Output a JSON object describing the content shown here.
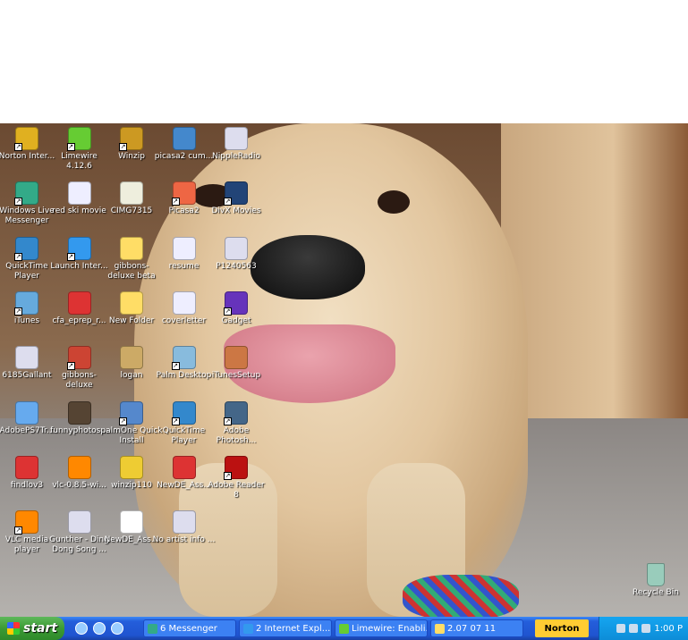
{
  "desktop_icons": [
    {
      "label": "Norton Inter...",
      "color": "#e0b020",
      "shortcut": true
    },
    {
      "label": "Limewire 4.12.6",
      "color": "#6c3",
      "shortcut": true
    },
    {
      "label": "Winzip",
      "color": "#c92",
      "shortcut": true
    },
    {
      "label": "picasa2 cum...",
      "color": "#48c",
      "shortcut": false
    },
    {
      "label": "NippleRadio",
      "color": "#dde",
      "shortcut": false
    },
    {
      "label": "Windows Live Messenger",
      "color": "#3a8",
      "shortcut": true
    },
    {
      "label": "red ski movie",
      "color": "#eef",
      "shortcut": false
    },
    {
      "label": "CIMG7315",
      "color": "#eed",
      "shortcut": false
    },
    {
      "label": "Picasa2",
      "color": "#e64",
      "shortcut": true
    },
    {
      "label": "DivX Movies",
      "color": "#247",
      "shortcut": true
    },
    {
      "label": "QuickTime Player",
      "color": "#38c",
      "shortcut": true
    },
    {
      "label": "Launch Inter...",
      "color": "#39e",
      "shortcut": true
    },
    {
      "label": "gibbons- deluxe beta",
      "color": "#fd6",
      "shortcut": false
    },
    {
      "label": "resume",
      "color": "#eef",
      "shortcut": false
    },
    {
      "label": "P1240563",
      "color": "#dde",
      "shortcut": false
    },
    {
      "label": "iTunes",
      "color": "#6ad",
      "shortcut": true
    },
    {
      "label": "cfa_eprep_r...",
      "color": "#d33",
      "shortcut": false
    },
    {
      "label": "New Folder",
      "color": "#fd6",
      "shortcut": false
    },
    {
      "label": "coverletter",
      "color": "#eef",
      "shortcut": false
    },
    {
      "label": "Gadget",
      "color": "#63b",
      "shortcut": true
    },
    {
      "label": "6185Gallant",
      "color": "#dde",
      "shortcut": false
    },
    {
      "label": "gibbons- deluxe",
      "color": "#c43",
      "shortcut": true
    },
    {
      "label": "logan",
      "color": "#ca6",
      "shortcut": false
    },
    {
      "label": "Palm Desktop",
      "color": "#8bd",
      "shortcut": true
    },
    {
      "label": "iTunesSetup",
      "color": "#c74",
      "shortcut": false
    },
    {
      "label": "AdobePS7Tr...",
      "color": "#6ae",
      "shortcut": false
    },
    {
      "label": "funnyphotos...",
      "color": "#543",
      "shortcut": false
    },
    {
      "label": "palmOne Quick Install",
      "color": "#58c",
      "shortcut": true
    },
    {
      "label": "QuickTime Player",
      "color": "#38c",
      "shortcut": true
    },
    {
      "label": "Adobe Photosh...",
      "color": "#468",
      "shortcut": true
    },
    {
      "label": "findlov3",
      "color": "#d33",
      "shortcut": false
    },
    {
      "label": "vlc-0.8.5-wi...",
      "color": "#f80",
      "shortcut": false
    },
    {
      "label": "winzip110",
      "color": "#ec3",
      "shortcut": false
    },
    {
      "label": "NewDE_Ass...",
      "color": "#d33",
      "shortcut": false
    },
    {
      "label": "Adobe Reader 8",
      "color": "#b11",
      "shortcut": true
    },
    {
      "label": "VLC media player",
      "color": "#f80",
      "shortcut": true
    },
    {
      "label": "Gunther - Ding Dong Song ...",
      "color": "#dde",
      "shortcut": false
    },
    {
      "label": "NewDE_Ass...",
      "color": "#fff",
      "shortcut": false
    },
    {
      "label": "No artist info ...",
      "color": "#dde",
      "shortcut": false
    }
  ],
  "recycle_bin": {
    "label": "Recycle Bin",
    "color": "#9cb"
  },
  "taskbar": {
    "start_label": "start",
    "tasks": [
      {
        "label": "6 Messenger",
        "color": "#3a8"
      },
      {
        "label": "2 Internet Expl...",
        "color": "#39e"
      },
      {
        "label": "Limewire: Enabli...",
        "color": "#6c3"
      },
      {
        "label": "2.07 07 11",
        "color": "#fd6"
      }
    ],
    "norton_label": "Norton",
    "clock": "1:00 P"
  }
}
